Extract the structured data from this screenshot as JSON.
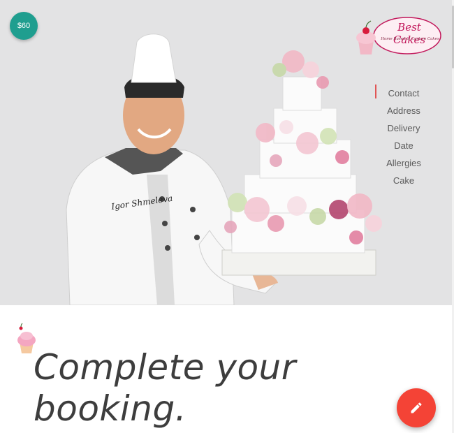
{
  "price_badge": {
    "label": "$60",
    "color": "#1f9e8f"
  },
  "logo": {
    "title": "Best Cakes",
    "subtitle": "Home Based & Custom Cakes",
    "icon": "cupcake-icon"
  },
  "hero": {
    "chef_jacket_logo": "Igor Shmeleva"
  },
  "nav": {
    "accent": "#e05555",
    "items": [
      {
        "label": "Contact"
      },
      {
        "label": "Address"
      },
      {
        "label": "Delivery"
      },
      {
        "label": "Date"
      },
      {
        "label": "Allergies"
      },
      {
        "label": "Cake"
      }
    ]
  },
  "booking": {
    "headline_line1": "Complete your",
    "headline_line2": "booking."
  },
  "fab": {
    "icon": "pencil-icon",
    "color": "#f44336"
  }
}
